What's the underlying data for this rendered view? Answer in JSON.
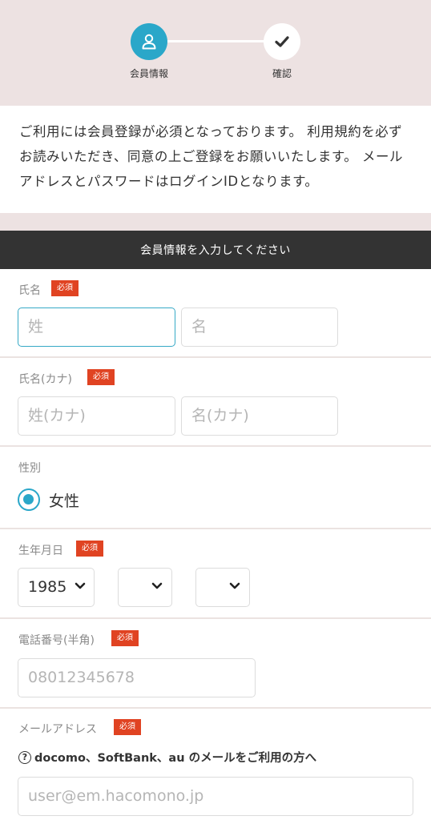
{
  "stepper": {
    "steps": [
      {
        "label": "会員情報",
        "icon": "user-icon",
        "state": "active"
      },
      {
        "label": "確認",
        "icon": "check-icon",
        "state": "pending"
      }
    ]
  },
  "intro_text": "ご利用には会員登録が必須となっております。 利用規約を必ずお読みいただき、同意の上ご登録をお願いいたします。 メールアドレスとパスワードはログインIDとなります。",
  "form": {
    "header": "会員情報を入力してください",
    "required_badge": "必須",
    "name": {
      "label": "氏名",
      "last_placeholder": "姓",
      "first_placeholder": "名"
    },
    "kana": {
      "label": "氏名(カナ)",
      "last_placeholder": "姓(カナ)",
      "first_placeholder": "名(カナ)"
    },
    "gender": {
      "label": "性別",
      "option": "女性",
      "selected": true
    },
    "birthday": {
      "label": "生年月日",
      "year": "1985",
      "month": "",
      "day": ""
    },
    "phone": {
      "label": "電話番号(半角)",
      "placeholder": "08012345678"
    },
    "email": {
      "label": "メールアドレス",
      "help_text": "docomo、SoftBank、au のメールをご利用の方へ",
      "placeholder": "user@em.hacomono.jp"
    }
  },
  "colors": {
    "accent": "#2aa7c9",
    "required": "#e04322",
    "header_bg": "#333333",
    "panel_bg": "#ede2e2"
  }
}
